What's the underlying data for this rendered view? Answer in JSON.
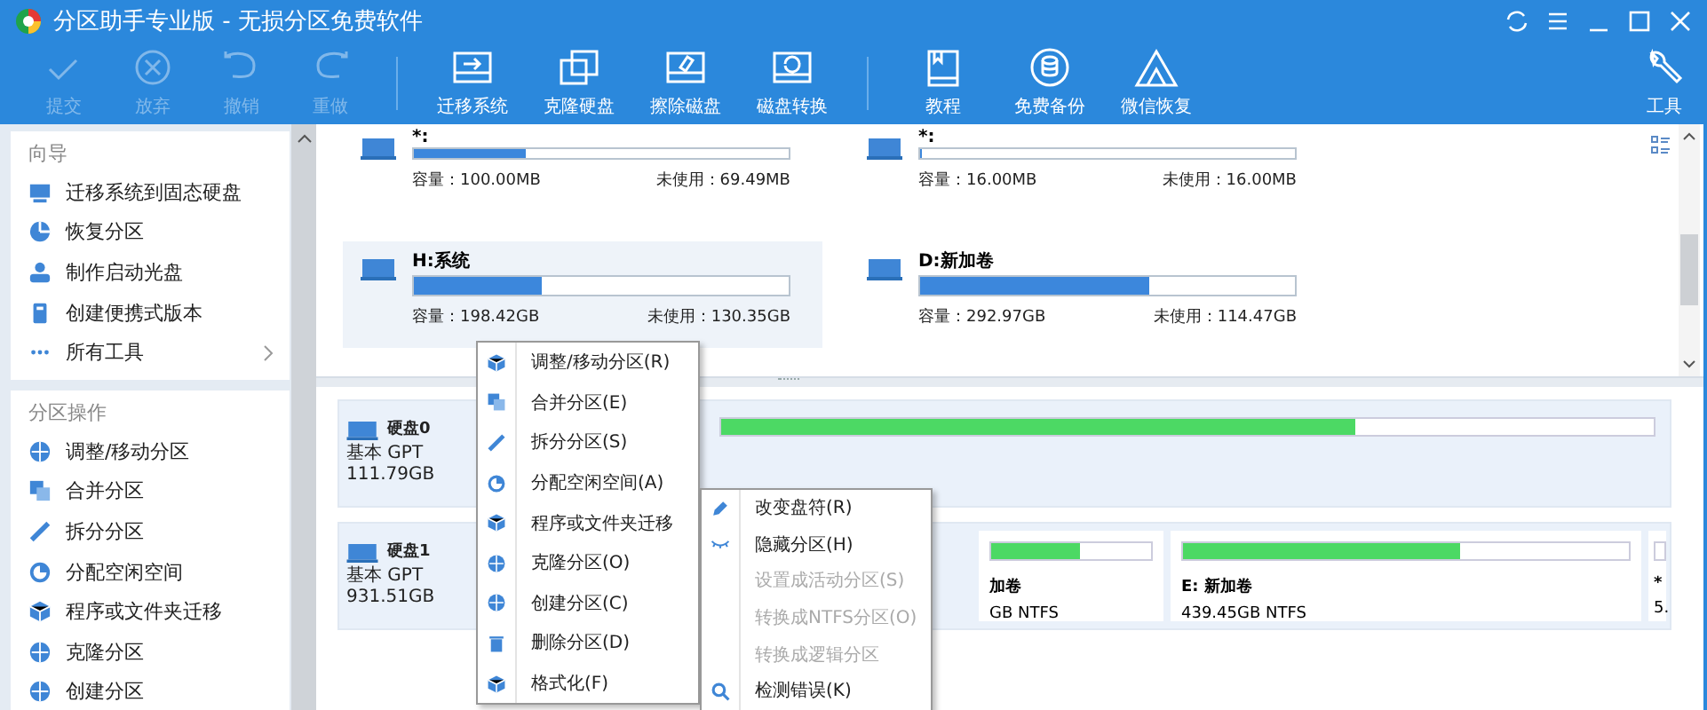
{
  "window": {
    "title": "分区助手专业版 - 无损分区免费软件"
  },
  "toolbar": {
    "groups": [
      [
        {
          "label": "提交",
          "disabled": true
        },
        {
          "label": "放弃",
          "disabled": true
        },
        {
          "label": "撤销",
          "disabled": true
        },
        {
          "label": "重做",
          "disabled": true
        }
      ],
      [
        {
          "label": "迁移系统",
          "disabled": false
        },
        {
          "label": "克隆硬盘",
          "disabled": false
        },
        {
          "label": "擦除磁盘",
          "disabled": false
        },
        {
          "label": "磁盘转换",
          "disabled": false
        }
      ],
      [
        {
          "label": "教程",
          "disabled": false
        },
        {
          "label": "免费备份",
          "disabled": false
        },
        {
          "label": "微信恢复",
          "disabled": false
        }
      ]
    ],
    "tools": {
      "label": "工具"
    }
  },
  "sidebar": {
    "sections": [
      {
        "title": "向导",
        "items": [
          {
            "label": "迁移系统到固态硬盘",
            "more": false
          },
          {
            "label": "恢复分区",
            "more": false
          },
          {
            "label": "制作启动光盘",
            "more": false
          },
          {
            "label": "创建便携式版本",
            "more": false
          },
          {
            "label": "所有工具",
            "more": true
          }
        ]
      },
      {
        "title": "分区操作",
        "items": [
          {
            "label": "调整/移动分区",
            "more": false
          },
          {
            "label": "合并分区",
            "more": false
          },
          {
            "label": "拆分分区",
            "more": false
          },
          {
            "label": "分配空闲空间",
            "more": false
          },
          {
            "label": "程序或文件夹迁移",
            "more": false
          },
          {
            "label": "克隆分区",
            "more": false
          },
          {
            "label": "创建分区",
            "more": false
          }
        ]
      }
    ]
  },
  "partitions": [
    {
      "name": "*:",
      "level": 0.3,
      "capacity": "容量：100.00MB",
      "free": "未使用：69.49MB",
      "selected": false
    },
    {
      "name": "*:",
      "level": 0,
      "capacity": "容量：16.00MB",
      "free": "未使用：16.00MB",
      "selected": false
    },
    {
      "name": "H:系统",
      "level": 0.34,
      "capacity": "容量：198.42GB",
      "free": "未使用：130.35GB",
      "selected": true
    },
    {
      "name": "D:新加卷",
      "level": 0.61,
      "capacity": "容量：292.97GB",
      "free": "未使用：114.47GB",
      "selected": false
    }
  ],
  "disks": [
    {
      "name": "硬盘0",
      "type": "基本 GPT",
      "size": "111.79GB",
      "partitions": [
        {
          "level": 0.68
        }
      ]
    },
    {
      "name": "硬盘1",
      "type": "基本 GPT",
      "size": "931.51GB",
      "partitions": [
        {
          "name": "加卷",
          "info": "GB NTFS",
          "level": 0.55
        },
        {
          "name": "E: 新加卷",
          "info": "439.45GB NTFS",
          "level": 0.62
        },
        {
          "name": "*",
          "info": "5."
        }
      ]
    }
  ],
  "menu": {
    "items": [
      {
        "label": "调整/移动分区(R)",
        "disabled": false
      },
      {
        "label": "合并分区(E)",
        "disabled": false
      },
      {
        "label": "拆分分区(S)",
        "disabled": false
      },
      {
        "label": "分配空闲空间(A)",
        "disabled": false
      },
      {
        "label": "程序或文件夹迁移",
        "disabled": false
      },
      {
        "label": "克隆分区(O)",
        "disabled": false
      },
      {
        "label": "创建分区(C)",
        "disabled": false
      },
      {
        "label": "删除分区(D)",
        "disabled": false
      },
      {
        "label": "格式化(F)",
        "disabled": false
      }
    ]
  },
  "submenu": {
    "items": [
      {
        "label": "改变盘符(R)",
        "disabled": false
      },
      {
        "label": "隐藏分区(H)",
        "disabled": false
      },
      {
        "label": "设置成活动分区(S)",
        "disabled": true
      },
      {
        "label": "转换成NTFS分区(O)",
        "disabled": true
      },
      {
        "label": "转换成逻辑分区",
        "disabled": true
      },
      {
        "label": "检测错误(K)",
        "disabled": false
      }
    ]
  }
}
